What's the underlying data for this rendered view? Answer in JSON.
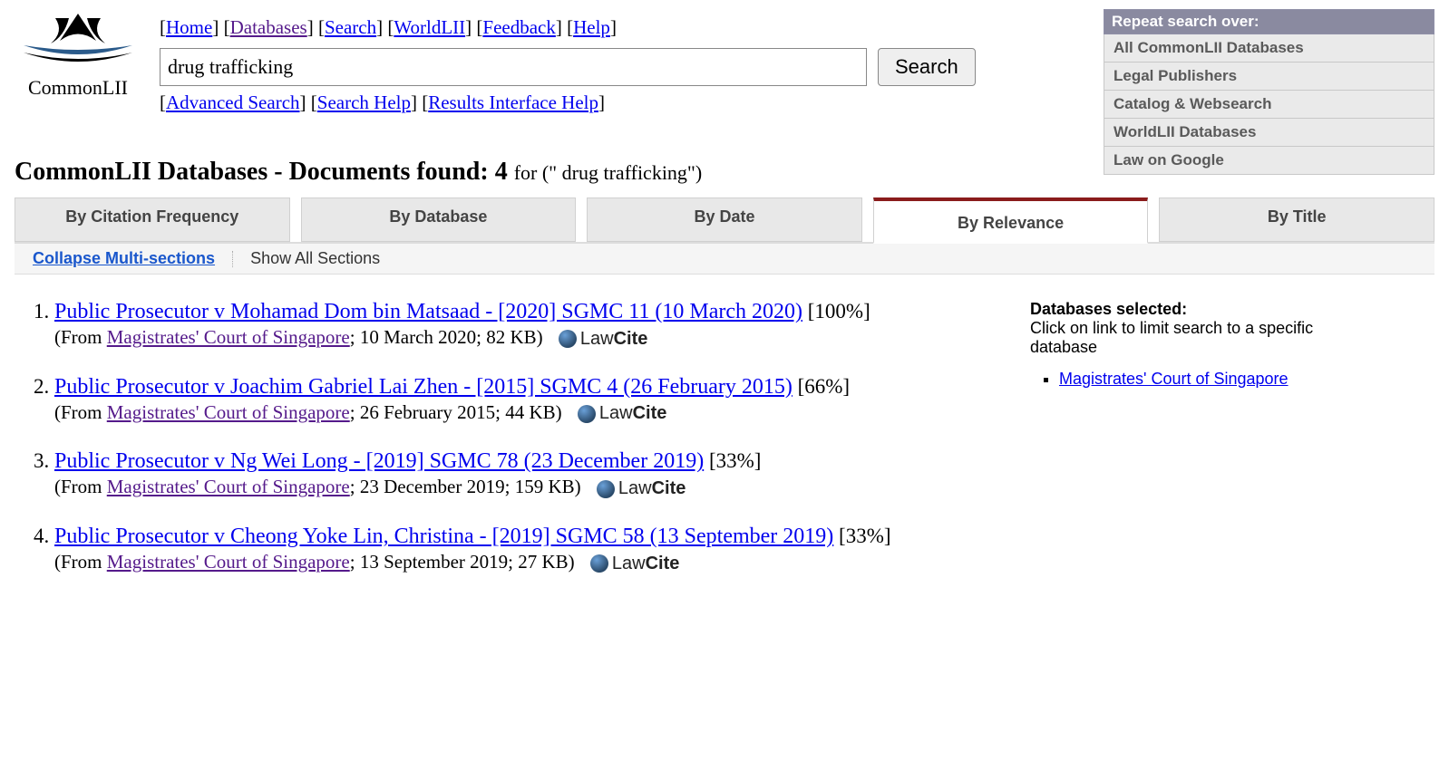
{
  "logo": {
    "text": "CommonLII"
  },
  "nav": {
    "links": [
      "Home",
      "Databases",
      "Search",
      "WorldLII",
      "Feedback",
      "Help"
    ]
  },
  "search": {
    "value": "drug trafficking",
    "button": "Search",
    "sublinks": [
      "Advanced Search",
      "Search Help",
      "Results Interface Help"
    ]
  },
  "repeat": {
    "heading": "Repeat search over:",
    "items": [
      "All CommonLII Databases",
      "Legal Publishers",
      "Catalog & Websearch",
      "WorldLII Databases",
      "Law on Google"
    ]
  },
  "heading": {
    "prefix": "CommonLII Databases - Documents found: ",
    "count": "4",
    "suffix": " for (\" drug trafficking\")"
  },
  "tabs": [
    "By Citation Frequency",
    "By Database",
    "By Date",
    "By Relevance",
    "By Title"
  ],
  "active_tab": 3,
  "subtabs": {
    "collapse": "Collapse Multi-sections",
    "showall": "Show All Sections"
  },
  "results": [
    {
      "title": "Public Prosecutor v Mohamad Dom bin Matsaad - [2020] SGMC 11 (10 March 2020)",
      "score": "[100%]",
      "from": "(From ",
      "db": "Magistrates' Court of Singapore",
      "meta": "; 10 March 2020; 82 KB)"
    },
    {
      "title": "Public Prosecutor v Joachim Gabriel Lai Zhen - [2015] SGMC 4 (26 February 2015)",
      "score": "[66%]",
      "from": "(From ",
      "db": "Magistrates' Court of Singapore",
      "meta": "; 26 February 2015; 44 KB)"
    },
    {
      "title": "Public Prosecutor v Ng Wei Long - [2019] SGMC 78 (23 December 2019)",
      "score": "[33%]",
      "from": "(From ",
      "db": "Magistrates' Court of Singapore",
      "meta": "; 23 December 2019; 159 KB)"
    },
    {
      "title": "Public Prosecutor v Cheong Yoke Lin, Christina - [2019] SGMC 58 (13 September 2019)",
      "score": "[33%]",
      "from": "(From ",
      "db": "Magistrates' Court of Singapore",
      "meta": "; 13 September 2019; 27 KB)"
    }
  ],
  "lawcite": {
    "law": "Law",
    "cite": "Cite"
  },
  "side": {
    "heading": "Databases selected:",
    "sub": "Click on link to limit search to a specific database",
    "items": [
      "Magistrates' Court of Singapore"
    ]
  }
}
